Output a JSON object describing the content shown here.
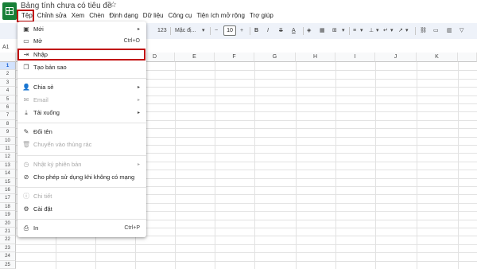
{
  "header": {
    "title": "Bảng tính chưa có tiêu đề",
    "star_icon": "star-icon"
  },
  "menubar": {
    "items": [
      "Tệp",
      "Chỉnh sửa",
      "Xem",
      "Chèn",
      "Định dạng",
      "Dữ liệu",
      "Công cụ",
      "Tiện ích mở rộng",
      "Trợ giúp"
    ]
  },
  "toolbar": {
    "number_format": "123",
    "font_name": "Mặc đị...",
    "font_size": "10",
    "minus": "−",
    "plus": "+"
  },
  "namebox": "A1",
  "columns": [
    "D",
    "E",
    "F",
    "G",
    "H",
    "I",
    "J",
    "K"
  ],
  "rows": [
    "1",
    "2",
    "3",
    "4",
    "5",
    "6",
    "7",
    "8",
    "9",
    "10",
    "11",
    "12",
    "13",
    "14",
    "15",
    "16",
    "17",
    "18",
    "19",
    "20",
    "21",
    "22",
    "23",
    "24",
    "25"
  ],
  "file_menu": {
    "items": [
      {
        "label": "Mới",
        "icon": "new-icon",
        "arrow": "▸"
      },
      {
        "label": "Mở",
        "icon": "folder-icon",
        "shortcut": "Ctrl+O"
      },
      {
        "label": "Nhập",
        "icon": "import-icon"
      },
      {
        "label": "Tạo bản sao",
        "icon": "copy-icon"
      },
      {
        "label": "Chia sẻ",
        "icon": "share-icon",
        "arrow": "▸"
      },
      {
        "label": "Email",
        "icon": "email-icon",
        "arrow": "▸"
      },
      {
        "label": "Tải xuống",
        "icon": "download-icon",
        "arrow": "▸"
      },
      {
        "label": "Đổi tên",
        "icon": "rename-icon"
      },
      {
        "label": "Chuyển vào thùng rác",
        "icon": "trash-icon"
      },
      {
        "label": "Nhật ký phiên bản",
        "icon": "history-icon",
        "arrow": "▸"
      },
      {
        "label": "Cho phép sử dụng khi không có mạng",
        "icon": "offline-icon"
      },
      {
        "label": "Chi tiết",
        "icon": "info-icon"
      },
      {
        "label": "Cài đặt",
        "icon": "settings-icon"
      },
      {
        "label": "In",
        "icon": "print-icon",
        "shortcut": "Ctrl+P"
      }
    ]
  },
  "colors": {
    "highlight": "#c00000",
    "brand": "#188038"
  }
}
